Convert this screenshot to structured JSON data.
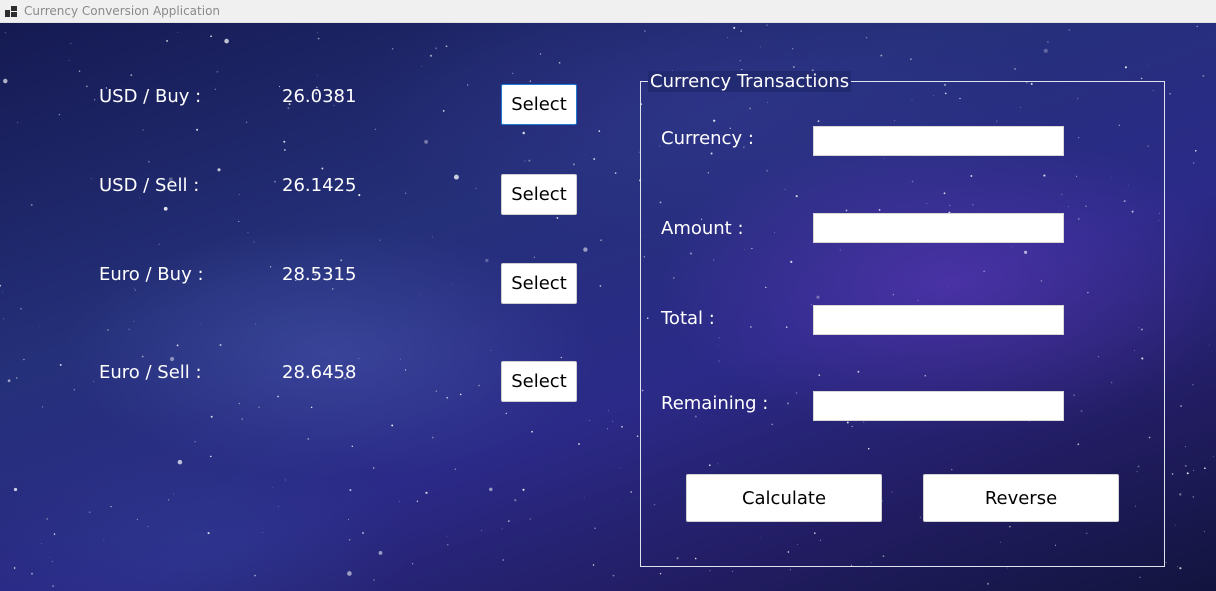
{
  "window": {
    "title": "Currency Conversion Application",
    "icon": "app-window-icon"
  },
  "rates": [
    {
      "label": "USD / Buy :",
      "value": "26.0381",
      "button": "Select"
    },
    {
      "label": "USD / Sell :",
      "value": "26.1425",
      "button": "Select"
    },
    {
      "label": "Euro / Buy :",
      "value": "28.5315",
      "button": "Select"
    },
    {
      "label": "Euro / Sell :",
      "value": "28.6458",
      "button": "Select"
    }
  ],
  "transactions": {
    "title": "Currency Transactions",
    "currency_label": "Currency :",
    "currency_value": "",
    "amount_label": "Amount  :",
    "amount_value": "",
    "total_label": "Total :",
    "total_value": "",
    "remaining_label": "Remaining :",
    "remaining_value": "",
    "calculate_label": "Calculate",
    "reverse_label": "Reverse"
  },
  "colors": {
    "background_primary": "#25307a",
    "background_secondary": "#2b2a88",
    "text": "#ffffff",
    "focus_border": "#1f7ad6"
  }
}
